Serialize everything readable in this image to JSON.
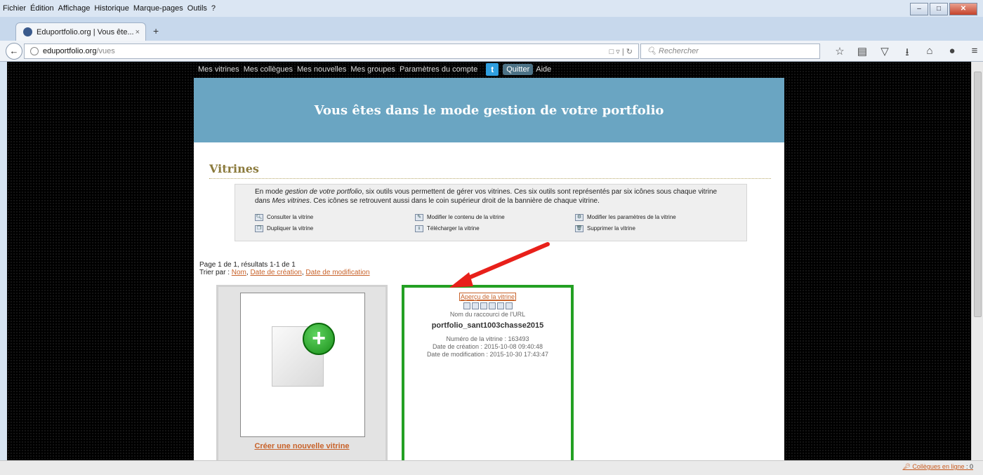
{
  "browser": {
    "menu": [
      "Fichier",
      "Édition",
      "Affichage",
      "Historique",
      "Marque-pages",
      "Outils",
      "?"
    ],
    "tab_title": "Eduportfolio.org | Vous ête...",
    "tab_close": "×",
    "new_tab": "+",
    "url_host": "eduportfolio.org",
    "url_path": "/vues",
    "search_placeholder": "Rechercher"
  },
  "topnav": {
    "items": [
      "Mes vitrines",
      "Mes collègues",
      "Mes nouvelles",
      "Mes groupes",
      "Paramètres du compte"
    ],
    "quit": "Quitter",
    "help": "Aide"
  },
  "banner": {
    "title": "Vous êtes dans le mode gestion de votre portfolio"
  },
  "section": {
    "title": "Vitrines"
  },
  "info": {
    "text_1": "En mode ",
    "text_em_1": "gestion de votre portfolio",
    "text_2": ", six outils vous permettent de gérer vos vitrines. Ces six outils sont représentés par six icônes sous chaque vitrine dans ",
    "text_em_2": "Mes vitrines",
    "text_3": ". Ces icônes se retrouvent aussi dans le coin supérieur droit de la bannière de chaque vitrine.",
    "tools": [
      "Consulter la vitrine",
      "Modifier le contenu de la vitrine",
      "Modifier les paramètres de la vitrine",
      "Dupliquer la vitrine",
      "Télécharger la vitrine",
      "Supprimer la vitrine"
    ]
  },
  "listing": {
    "page_info": "Page 1 de 1, résultats 1-1 de 1",
    "sort_label": "Trier par : ",
    "sort_name": "Nom",
    "sort_created": "Date de création",
    "sort_modified": "Date de modification",
    "sep": ", "
  },
  "new_vitrine": {
    "label": "Créer une nouvelle vitrine"
  },
  "vitrine": {
    "preview": "Aperçu de la vitrine",
    "url_label": "Nom du raccourci de l'URL",
    "name": "portfolio_sant1003chasse2015",
    "number": "Numéro de la vitrine : 163493",
    "created": "Date de création : 2015-10-08 09:40:48",
    "modified": "Date de modification : 2015-10-30 17:43:47"
  },
  "status": {
    "online_label": "Collègues en ligne",
    "online_count": ": 0"
  },
  "colors": {
    "accent_orange": "#c8622a",
    "banner_blue": "#6aa5c2",
    "frame_green": "#23a023",
    "arrow_red": "#e8201a"
  }
}
